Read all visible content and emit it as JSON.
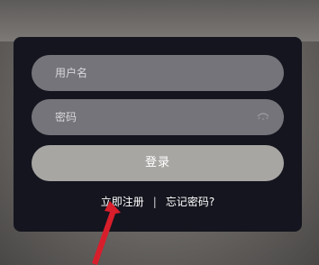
{
  "form": {
    "username_placeholder": "用户名",
    "password_placeholder": "密码",
    "login_label": "登录"
  },
  "links": {
    "register_label": "立即注册",
    "separator": "|",
    "forgot_label": "忘记密码?"
  },
  "colors": {
    "card": "#15151f",
    "field": "#74747a",
    "button": "#a8a6a3",
    "arrow": "#d81e2b"
  },
  "icons": {
    "password_toggle": "eye-off-icon",
    "pointer": "red-arrow"
  }
}
